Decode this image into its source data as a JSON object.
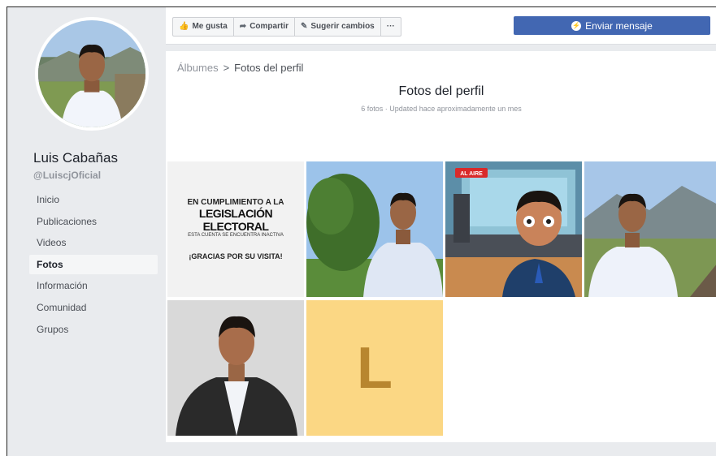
{
  "profile": {
    "name": "Luis Cabañas",
    "handle": "@LuiscjOficial"
  },
  "sidebar": {
    "items": [
      {
        "label": "Inicio"
      },
      {
        "label": "Publicaciones"
      },
      {
        "label": "Videos"
      },
      {
        "label": "Fotos"
      },
      {
        "label": "Información"
      },
      {
        "label": "Comunidad"
      },
      {
        "label": "Grupos"
      }
    ],
    "active": "Fotos"
  },
  "toolbar": {
    "like_label": "Me gusta",
    "share_label": "Compartir",
    "suggest_label": "Sugerir cambios",
    "more_label": "···",
    "message_label": "Enviar mensaje"
  },
  "album": {
    "breadcrumb_root": "Álbumes",
    "breadcrumb_sep": ">",
    "breadcrumb_current": "Fotos del perfil",
    "title": "Fotos del perfil",
    "meta": "6 fotos · Updated hace aproximadamente un mes"
  },
  "photos": {
    "notice_line1": "EN CUMPLIMIENTO A LA",
    "notice_line2": "LEGISLACIÓN ELECTORAL",
    "notice_line3": "ESTA CUENTA SE ENCUENTRA INACTIVA",
    "notice_line4": "¡GRACIAS POR SU VISITA!",
    "cartoon_badge": "AL AIRE",
    "letter": "L"
  },
  "colors": {
    "accent": "#4267b2",
    "page_bg": "#e9ebee",
    "letter_bg": "#fbd784",
    "letter_fg": "#b8862f"
  }
}
